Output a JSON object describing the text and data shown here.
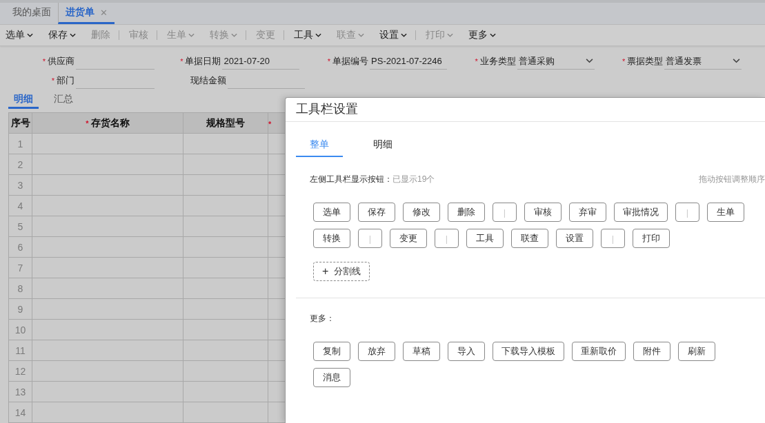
{
  "required_mark": "*",
  "tabs": [
    {
      "label": "我的桌面",
      "selected": false,
      "closable": false
    },
    {
      "label": "进货单",
      "selected": true,
      "closable": true,
      "close_glyph": "✕"
    }
  ],
  "toolbar": [
    {
      "kind": "button",
      "label": "选单",
      "caret": true,
      "disabled": false
    },
    {
      "kind": "button",
      "label": "保存",
      "caret": true,
      "disabled": false
    },
    {
      "kind": "button",
      "label": "删除",
      "caret": false,
      "disabled": true
    },
    {
      "kind": "separator"
    },
    {
      "kind": "button",
      "label": "审核",
      "caret": false,
      "disabled": true
    },
    {
      "kind": "separator"
    },
    {
      "kind": "button",
      "label": "生单",
      "caret": true,
      "disabled": true
    },
    {
      "kind": "button",
      "label": "转换",
      "caret": true,
      "disabled": true
    },
    {
      "kind": "separator"
    },
    {
      "kind": "button",
      "label": "变更",
      "caret": false,
      "disabled": true
    },
    {
      "kind": "separator"
    },
    {
      "kind": "button",
      "label": "工具",
      "caret": true,
      "disabled": false
    },
    {
      "kind": "button",
      "label": "联查",
      "caret": true,
      "disabled": true
    },
    {
      "kind": "button",
      "label": "设置",
      "caret": true,
      "disabled": false
    },
    {
      "kind": "separator"
    },
    {
      "kind": "button",
      "label": "打印",
      "caret": true,
      "disabled": true
    },
    {
      "kind": "button",
      "label": "更多",
      "caret": true,
      "disabled": false
    }
  ],
  "form_rows": [
    [
      {
        "label": "供应商",
        "required": true,
        "kind": "text"
      },
      {
        "label": "单据日期",
        "required": true,
        "kind": "text",
        "value": "2021-07-20"
      },
      {
        "label": "单据编号",
        "required": true,
        "kind": "text",
        "value": "PS-2021-07-2246"
      },
      {
        "label": "业务类型",
        "required": true,
        "kind": "select",
        "value": "普通采购"
      },
      {
        "label": "票据类型",
        "required": true,
        "kind": "select",
        "value": "普通发票"
      }
    ],
    [
      {
        "label": "部门",
        "required": true,
        "kind": "text"
      },
      {
        "label": "现结金额",
        "required": false,
        "kind": "text"
      }
    ]
  ],
  "detail_tabs": [
    {
      "label": "明细",
      "selected": true
    },
    {
      "label": "汇总",
      "selected": false
    }
  ],
  "table": {
    "columns": [
      {
        "label": "序号",
        "required": false
      },
      {
        "label": "存货名称",
        "required": true
      },
      {
        "label": "规格型号",
        "required": false
      },
      {
        "required": true
      }
    ],
    "rows": [
      "1",
      "2",
      "3",
      "4",
      "5",
      "6",
      "7",
      "8",
      "9",
      "10",
      "11",
      "12",
      "13",
      "14"
    ]
  },
  "dialog": {
    "title": "工具栏设置",
    "tabs": [
      {
        "label": "整单",
        "selected": true
      },
      {
        "label": "明细",
        "selected": false
      }
    ],
    "section_label": "左侧工具栏显示按钮：",
    "count_text": "已显示19个",
    "hint": "拖动按钮调整顺序",
    "buttons": [
      {
        "kind": "button",
        "label": "选单"
      },
      {
        "kind": "button",
        "label": "保存"
      },
      {
        "kind": "button",
        "label": "修改"
      },
      {
        "kind": "button",
        "label": "删除"
      },
      {
        "kind": "separator",
        "label": "|"
      },
      {
        "kind": "button",
        "label": "审核"
      },
      {
        "kind": "button",
        "label": "弃审"
      },
      {
        "kind": "button",
        "label": "审批情况"
      },
      {
        "kind": "separator",
        "label": "|"
      },
      {
        "kind": "button",
        "label": "生单"
      },
      {
        "kind": "button",
        "label": "转换"
      },
      {
        "kind": "separator",
        "label": "|"
      },
      {
        "kind": "button",
        "label": "变更"
      },
      {
        "kind": "separator",
        "label": "|"
      },
      {
        "kind": "button",
        "label": "工具"
      },
      {
        "kind": "button",
        "label": "联查"
      },
      {
        "kind": "button",
        "label": "设置"
      },
      {
        "kind": "separator",
        "label": "|"
      },
      {
        "kind": "button",
        "label": "打印"
      }
    ],
    "add_button": {
      "glyph": "+",
      "label": "分割线"
    },
    "more_label": "更多：",
    "more_buttons": [
      "复制",
      "放弃",
      "草稿",
      "导入",
      "下载导入模板",
      "重新取价",
      "附件",
      "刷新",
      "消息"
    ]
  }
}
